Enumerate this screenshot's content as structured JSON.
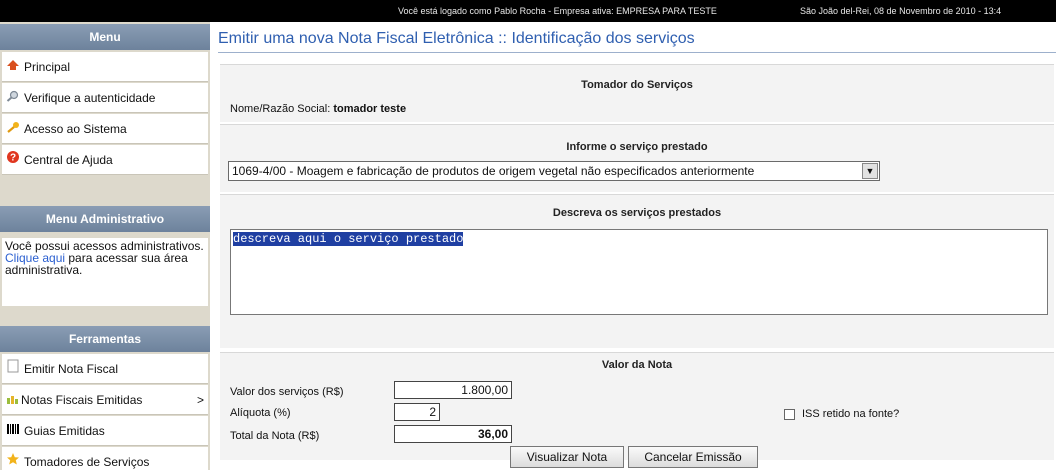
{
  "topbar": {
    "login_text": "Você está logado como Pablo Rocha - Empresa ativa: EMPRESA PARA TESTE",
    "location_date": "São João del-Rei, 08 de Novembro de 2010 - 13:4"
  },
  "sidebar": {
    "menu_title": "Menu",
    "menu_items": [
      {
        "label": "Principal",
        "icon": "home-icon"
      },
      {
        "label": "Verifique a autenticidade",
        "icon": "magnifier-icon"
      },
      {
        "label": "Acesso ao Sistema",
        "icon": "key-icon"
      },
      {
        "label": "Central de Ajuda",
        "icon": "help-icon"
      }
    ],
    "admin_title": "Menu Administrativo",
    "admin_text_1": "Você possui acessos administrativos. ",
    "admin_link": "Clique aqui",
    "admin_text_2": " para acessar sua área administrativa.",
    "tools_title": "Ferramentas",
    "tool_items": [
      {
        "label": "Emitir Nota Fiscal",
        "icon": "document-icon"
      },
      {
        "label": "Notas Fiscais Emitidas",
        "icon": "bar-chart-icon",
        "arrow": ">"
      },
      {
        "label": "Guias Emitidas",
        "icon": "barcode-icon"
      },
      {
        "label": "Tomadores de Serviços",
        "icon": "star-icon"
      }
    ]
  },
  "main": {
    "page_title": "Emitir uma nova Nota Fiscal Eletrônica :: Identificação dos serviços",
    "tomador": {
      "header": "Tomador do Serviços",
      "name_label": "Nome/Razão Social: ",
      "name_value": "tomador teste"
    },
    "servico": {
      "header": "Informe o serviço prestado",
      "selected": "1069-4/00 - Moagem e fabricação de produtos de origem vegetal não especificados anteriormente"
    },
    "descricao": {
      "header": "Descreva os serviços prestados",
      "value": "descreva aqui o serviço prestado"
    },
    "valor": {
      "header": "Valor da Nota",
      "servicos_label": "Valor dos serviços (R$)",
      "servicos_value": "1.800,00",
      "aliquota_label": "Alíquota (%)",
      "aliquota_value": "2",
      "total_label": "Total da Nota (R$)",
      "total_value": "36,00",
      "iss_label": "ISS retido na fonte?"
    },
    "buttons": {
      "preview": "Visualizar Nota",
      "cancel": "Cancelar Emissão"
    }
  }
}
